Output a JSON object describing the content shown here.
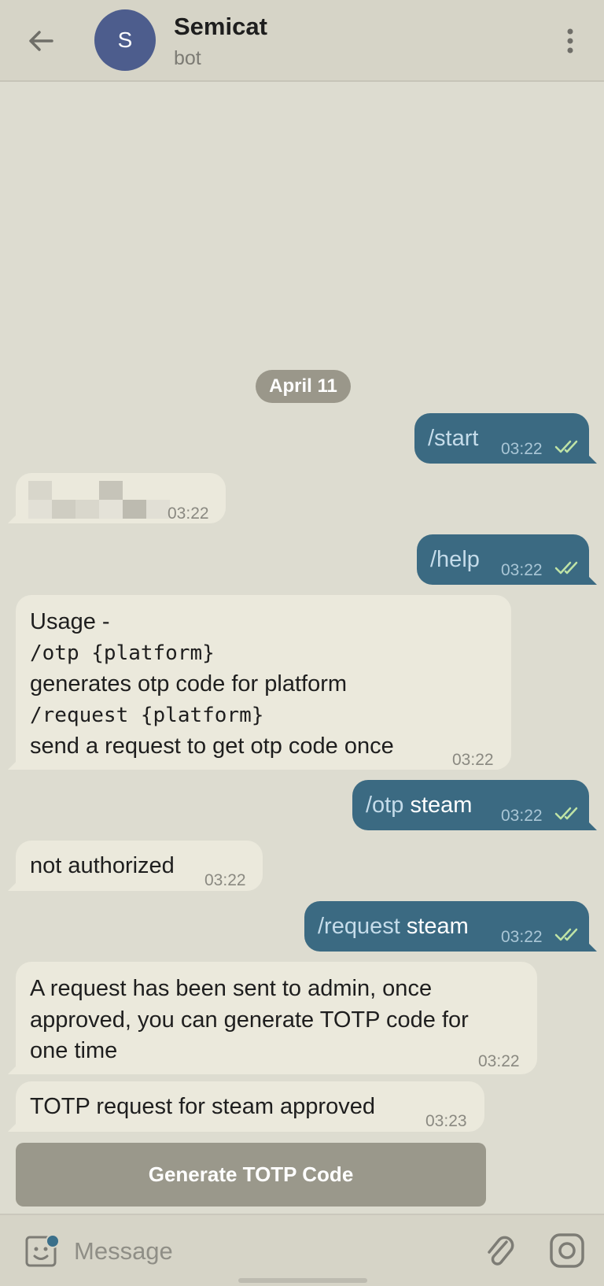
{
  "header": {
    "avatar_letter": "S",
    "title": "Semicat",
    "subtitle": "bot",
    "avatar_color": "#4d5d8d"
  },
  "date_separator": "April 11",
  "messages": [
    {
      "dir": "out",
      "cmd": "/start",
      "arg": "",
      "time": "03:22",
      "status": "read"
    },
    {
      "dir": "in",
      "text": "",
      "redacted": true,
      "time": "03:22"
    },
    {
      "dir": "out",
      "cmd": "/help",
      "arg": "",
      "time": "03:22",
      "status": "read"
    },
    {
      "dir": "in",
      "lines": [
        "Usage -",
        "/otp {platform}",
        "generates otp code for platform",
        "/request {platform}",
        "send a request to get otp code once"
      ],
      "time": "03:22"
    },
    {
      "dir": "out",
      "cmd": "/otp",
      "arg": "steam",
      "time": "03:22",
      "status": "read"
    },
    {
      "dir": "in",
      "text": "not authorized",
      "time": "03:22"
    },
    {
      "dir": "out",
      "cmd": "/request",
      "arg": "steam",
      "time": "03:22",
      "status": "read"
    },
    {
      "dir": "in",
      "lines": [
        "A request has been sent to admin, once",
        "approved, you can generate TOTP code for",
        "one time"
      ],
      "time": "03:22"
    },
    {
      "dir": "in",
      "text": "TOTP request for steam approved",
      "time": "03:23"
    }
  ],
  "inline_button": "Generate TOTP Code",
  "composer": {
    "placeholder": "Message"
  },
  "icons": {
    "back": "arrow-left-icon",
    "menu": "vertical-dots-icon",
    "read_receipt": "double-check-icon",
    "emoji": "sticker-emoji-icon",
    "attach": "paperclip-icon",
    "camera": "instagram-camera-icon"
  },
  "colors": {
    "outgoing_bubble": "#3b6a82",
    "incoming_bubble": "#ebe9dc",
    "background": "#dddcd0",
    "command_text": "#c5dcea",
    "read_check": "#bfe3a6"
  }
}
